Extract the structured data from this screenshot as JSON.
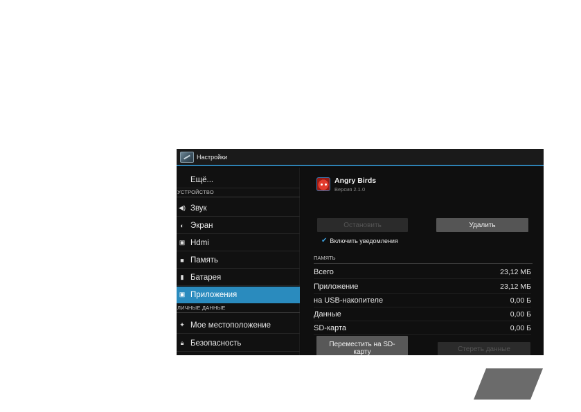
{
  "window": {
    "title": "Настройки"
  },
  "sidebar": {
    "top_item": "Ещё...",
    "section_device": "УСТРОЙСТВО",
    "device_items": [
      {
        "label": "Звук",
        "icon": "volume-icon"
      },
      {
        "label": "Экран",
        "icon": "display-icon"
      },
      {
        "label": "Hdmi",
        "icon": "hdmi-icon"
      },
      {
        "label": "Память",
        "icon": "storage-icon"
      },
      {
        "label": "Батарея",
        "icon": "battery-icon"
      },
      {
        "label": "Приложения",
        "icon": "apps-icon",
        "selected": true
      }
    ],
    "section_personal": "ЛИЧНЫЕ ДАННЫЕ",
    "personal_items": [
      {
        "label": "Мое местоположение",
        "icon": "location-icon"
      },
      {
        "label": "Безопасность",
        "icon": "lock-icon"
      }
    ]
  },
  "app": {
    "name": "Angry Birds",
    "version": "Версия 2.1.0",
    "stop_label": "Остановить",
    "delete_label": "Удалить",
    "notifications_label": "Включить уведомления",
    "notifications_checked": true
  },
  "storage": {
    "header": "ПАМЯТЬ",
    "rows": [
      {
        "label": "Всего",
        "value": "23,12 МБ"
      },
      {
        "label": "Приложение",
        "value": "23,12 МБ"
      },
      {
        "label": "на USB-накопителе",
        "value": "0,00 Б"
      },
      {
        "label": "Данные",
        "value": "0,00 Б"
      },
      {
        "label": "SD-карта",
        "value": "0,00 Б"
      }
    ],
    "move_label": "Переместить на SD-карту",
    "clear_label": "Стереть данные"
  },
  "colors": {
    "accent": "#2a8bbe",
    "background": "#0d0d0d",
    "button": "#555555",
    "page_tab": "#6b6b6b"
  }
}
